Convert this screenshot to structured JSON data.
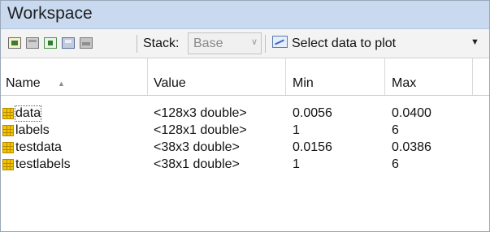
{
  "panel": {
    "title": "Workspace"
  },
  "toolbar": {
    "icons": [
      "new-variable-icon",
      "open-variable-icon",
      "import-data-icon",
      "save-workspace-icon",
      "print-icon"
    ],
    "stack_label": "Stack:",
    "stack_value": "Base",
    "plot_label": "Select data to plot"
  },
  "table": {
    "columns": [
      "Name",
      "Value",
      "Min",
      "Max"
    ],
    "sort_column": "Name",
    "sort_direction": "ascending",
    "rows": [
      {
        "name": "data",
        "value": "<128x3 double>",
        "min": "0.0056",
        "max": "0.0400"
      },
      {
        "name": "labels",
        "value": "<128x1 double>",
        "min": "1",
        "max": "6"
      },
      {
        "name": "testdata",
        "value": "<38x3 double>",
        "min": "0.0156",
        "max": "0.0386"
      },
      {
        "name": "testlabels",
        "value": "<38x1 double>",
        "min": "1",
        "max": "6"
      }
    ]
  },
  "colors": {
    "titlebar": "#c9daf0",
    "toolbar": "#f3f3f3",
    "variable_icon": "#f5c400"
  }
}
